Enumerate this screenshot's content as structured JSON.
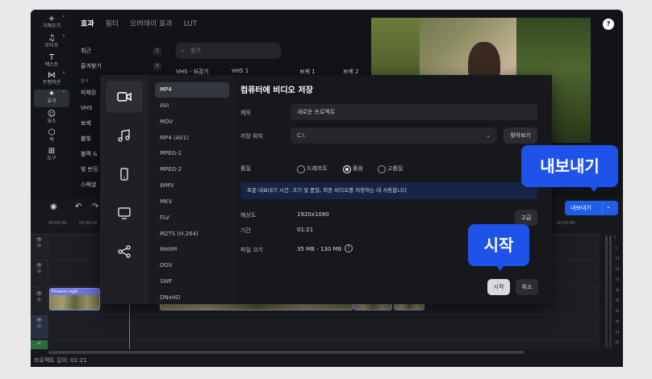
{
  "toolbar": {
    "items": [
      {
        "icon": "+",
        "label": "가져오기"
      },
      {
        "icon": "♫",
        "label": "오디오"
      },
      {
        "icon": "T",
        "label": "텍스트"
      },
      {
        "icon": "⋈",
        "label": "트랜지션"
      },
      {
        "icon": "✦",
        "label": "효과"
      },
      {
        "icon": "☺",
        "label": "요소"
      },
      {
        "icon": "⬡",
        "label": "릭"
      },
      {
        "icon": "⊞",
        "label": "도구"
      }
    ]
  },
  "effects": {
    "tabs": [
      "효과",
      "필터",
      "오버레이 효과",
      "LUT"
    ],
    "categories": [
      {
        "label": "최근",
        "count": "2"
      },
      {
        "label": "즐겨찾기",
        "count": "0"
      },
      {
        "label": "형식",
        "count": ""
      },
      {
        "label": "피제장",
        "count": ""
      },
      {
        "label": "VHS",
        "count": ""
      },
      {
        "label": "보케",
        "count": ""
      },
      {
        "label": "불빛",
        "count": ""
      },
      {
        "label": "블랙 &",
        "count": ""
      },
      {
        "label": "빛 번짐",
        "count": ""
      },
      {
        "label": "스페셜",
        "count": ""
      }
    ],
    "search_placeholder": "찾기",
    "items": [
      "VHS - 되감기",
      "VHS 1",
      "보케 1",
      "보케 2"
    ]
  },
  "preview": {
    "help": "?"
  },
  "export_button": {
    "label": "내보내기",
    "dropdown": "⌄"
  },
  "dialog": {
    "title": "컴퓨터에 비디오 저장",
    "formats": [
      "MP4",
      "AVI",
      "MOV",
      "MP4 (AV1)",
      "MPEG-1",
      "MPEG-2",
      "WMV",
      "MKV",
      "FLV",
      "M2TS (H.264)",
      "WebM",
      "OGV",
      "SWF",
      "DNxHD"
    ],
    "selected_format": "MP4",
    "fields": {
      "title_label": "제목",
      "title_value": "새로운 프로젝트",
      "location_label": "저장 위치",
      "location_value": "C:\\",
      "browse": "찾아보기",
      "quality_label": "품질",
      "quality_options": [
        "드래프트",
        "좋음",
        "고품질"
      ],
      "quality_selected": "좋음",
      "info": "표준 내보내기 시간, 크기 및 품질, 최종 비디오를 저장하는 데 사용합니다",
      "resolution_label": "해상도",
      "resolution_value": "1920x1080",
      "advanced": "고급",
      "duration_label": "기간",
      "duration_value": "01:21",
      "filesize_label": "파일 크기",
      "filesize_value": "35 MB - 130 MB"
    },
    "start": "시작",
    "cancel": "취소"
  },
  "timeline": {
    "ruler": [
      "00:00:00",
      "00:00:10",
      "00:01:50"
    ],
    "clip_label": "Flowers.mp4",
    "project_length": "프로젝트 길이: 01:21",
    "meter_labels": [
      "0",
      "-6",
      "-12",
      "-18",
      "-24",
      "-30",
      "-36",
      "-42",
      "-48",
      "-54",
      "-60"
    ]
  },
  "callouts": {
    "export": "내보내기",
    "start": "시작"
  },
  "colors": {
    "accent": "#1f52e8",
    "background": "#121317"
  }
}
